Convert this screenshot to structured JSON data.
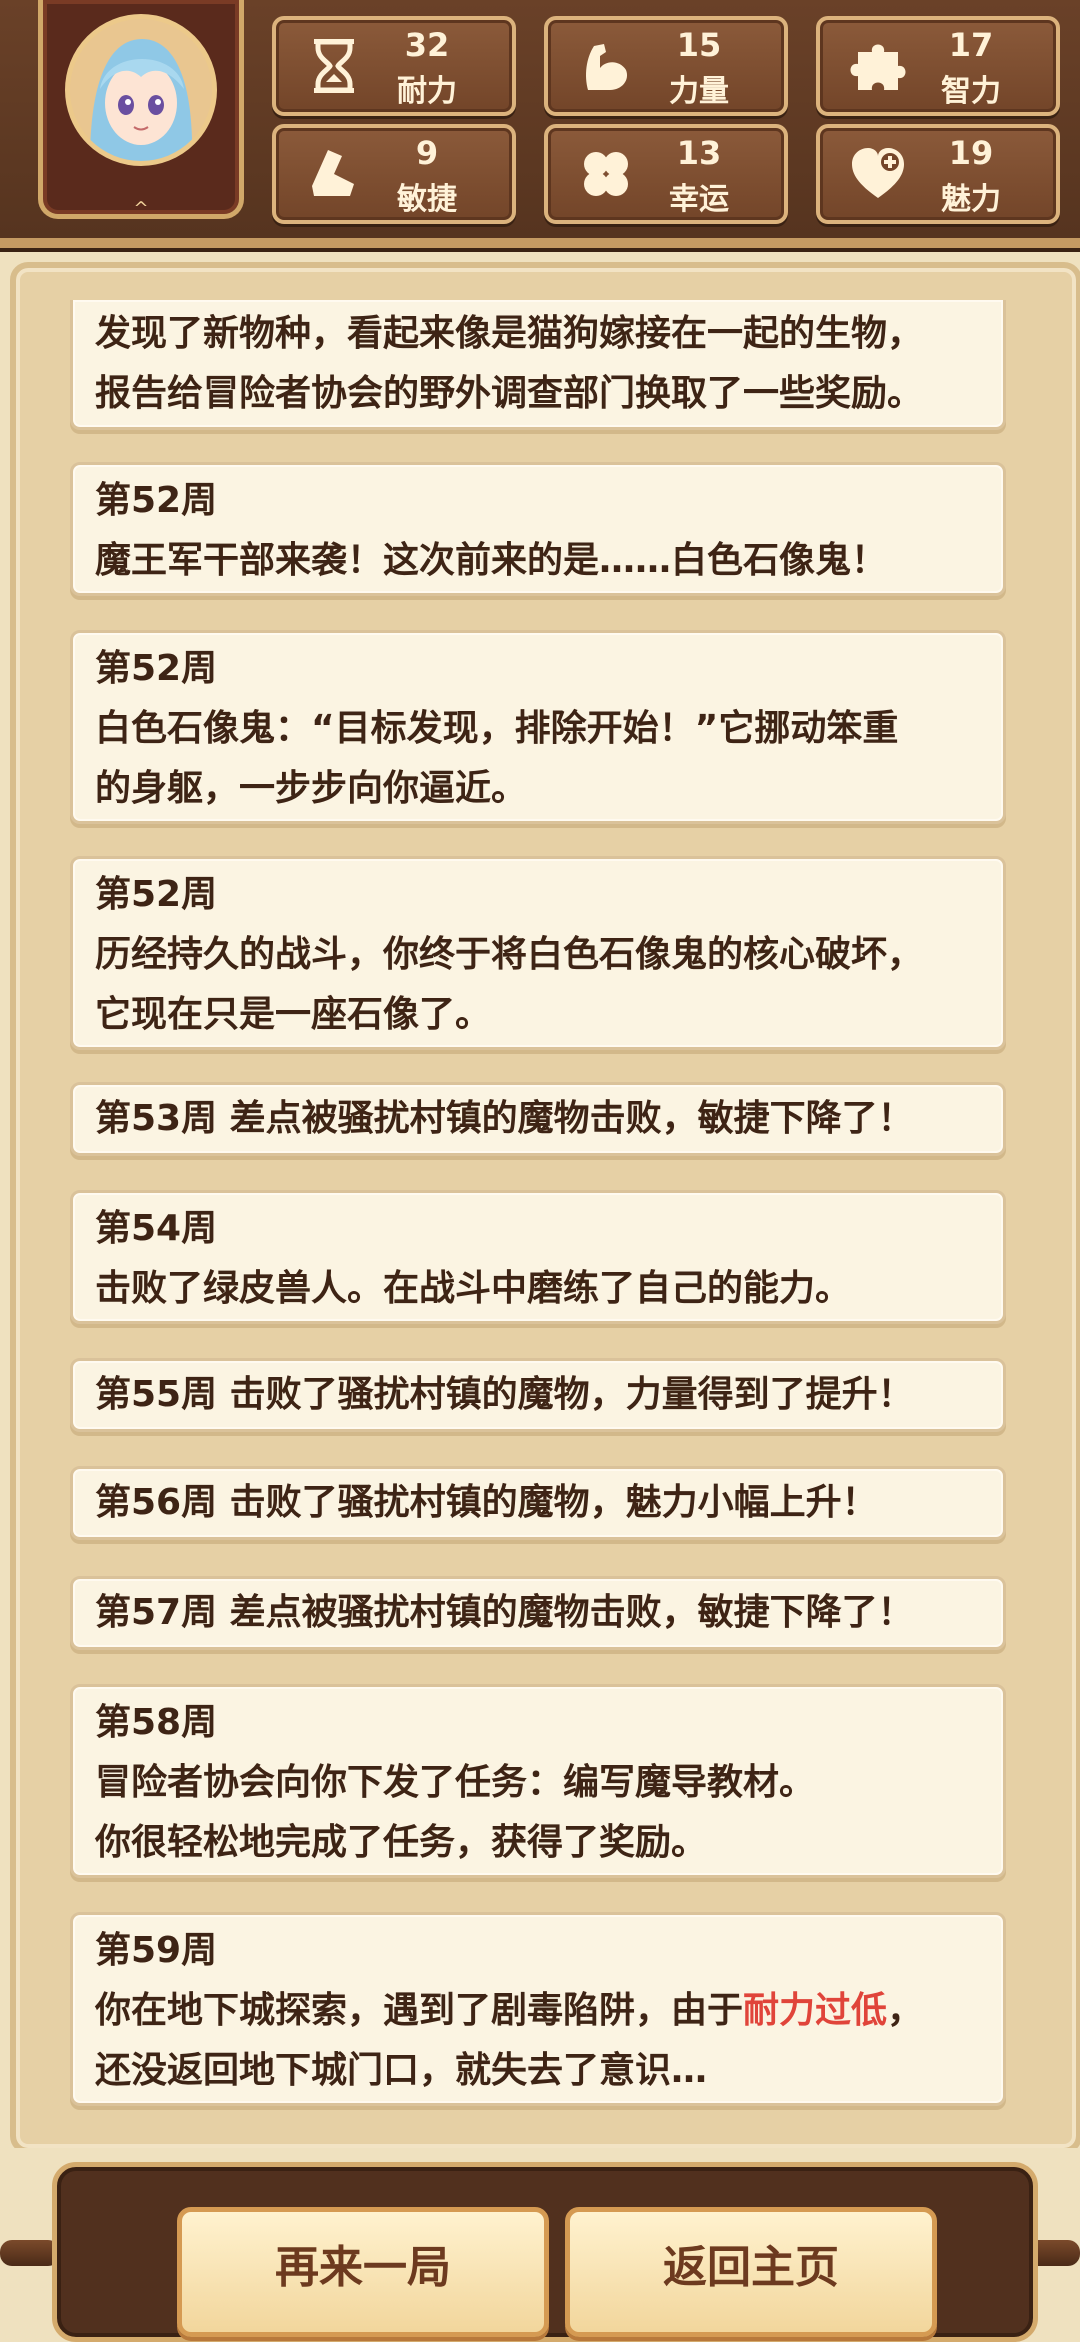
{
  "stats": [
    {
      "value": "32",
      "label": "耐力",
      "icon": "hourglass-icon"
    },
    {
      "value": "15",
      "label": "力量",
      "icon": "muscle-arm-icon"
    },
    {
      "value": "17",
      "label": "智力",
      "icon": "puzzle-icon"
    },
    {
      "value": "9",
      "label": "敏捷",
      "icon": "boot-icon"
    },
    {
      "value": "13",
      "label": "幸运",
      "icon": "clover-icon"
    },
    {
      "value": "19",
      "label": "魅力",
      "icon": "heart-plus-icon"
    }
  ],
  "log": [
    {
      "week": "",
      "lines": [
        "发现了新物种，看起来像是猫狗嫁接在一起的生物，",
        "报告给冒险者协会的野外调查部门换取了一些奖励。"
      ]
    },
    {
      "week": "第52周",
      "lines": [
        "魔王军干部来袭！这次前来的是……白色石像鬼！"
      ]
    },
    {
      "week": "第52周",
      "lines": [
        "白色石像鬼：“目标发现，排除开始！”它挪动笨重",
        "的身躯，一步步向你逼近。"
      ]
    },
    {
      "week": "第52周",
      "lines": [
        "历经持久的战斗，你终于将白色石像鬼的核心破坏，",
        "它现在只是一座石像了。"
      ]
    },
    {
      "week": "",
      "lines": [
        "第53周 差点被骚扰村镇的魔物击败，敏捷下降了！"
      ]
    },
    {
      "week": "第54周",
      "lines": [
        "击败了绿皮兽人。在战斗中磨练了自己的能力。"
      ]
    },
    {
      "week": "",
      "lines": [
        "第55周 击败了骚扰村镇的魔物，力量得到了提升！"
      ]
    },
    {
      "week": "",
      "lines": [
        "第56周 击败了骚扰村镇的魔物，魅力小幅上升！"
      ]
    },
    {
      "week": "",
      "lines": [
        "第57周 差点被骚扰村镇的魔物击败，敏捷下降了！"
      ]
    },
    {
      "week": "第58周",
      "lines": [
        "冒险者协会向你下发了任务：编写魔导教材。",
        "你很轻松地完成了任务，获得了奖励。"
      ]
    },
    {
      "week": "第59周",
      "lines_a": "你在地下城探索，遇到了剧毒陷阱，由于",
      "highlight": "耐力过低",
      "lines_b": "，",
      "line2": "还没返回地下城门口，就失去了意识…"
    }
  ],
  "buttons": {
    "replay": "再来一局",
    "home": "返回主页"
  },
  "colors": {
    "highlight": "#e0443a",
    "panel": "#efe1bf",
    "header": "#5c3822"
  }
}
